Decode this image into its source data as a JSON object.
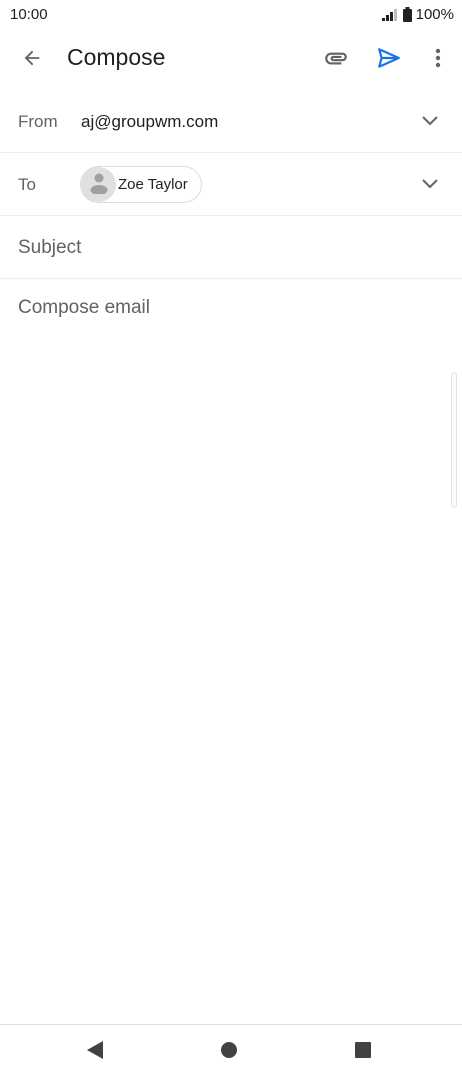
{
  "status_bar": {
    "time": "10:00",
    "battery": "100%",
    "icons": [
      "signal-icon",
      "battery-icon"
    ]
  },
  "app_bar": {
    "title": "Compose",
    "icons": [
      "back-arrow-icon",
      "paperclip-icon",
      "send-icon",
      "more-vert-icon"
    ],
    "send_color": "#1a73e8"
  },
  "from": {
    "label": "From",
    "value": "aj@groupwm.com"
  },
  "to": {
    "label": "To",
    "recipients": [
      {
        "name": "Zoe Taylor"
      }
    ]
  },
  "subject": {
    "placeholder": "Subject"
  },
  "body": {
    "placeholder": "Compose email"
  },
  "nav_bar": {
    "icons": [
      "nav-back-icon",
      "nav-home-icon",
      "nav-recents-icon"
    ]
  }
}
